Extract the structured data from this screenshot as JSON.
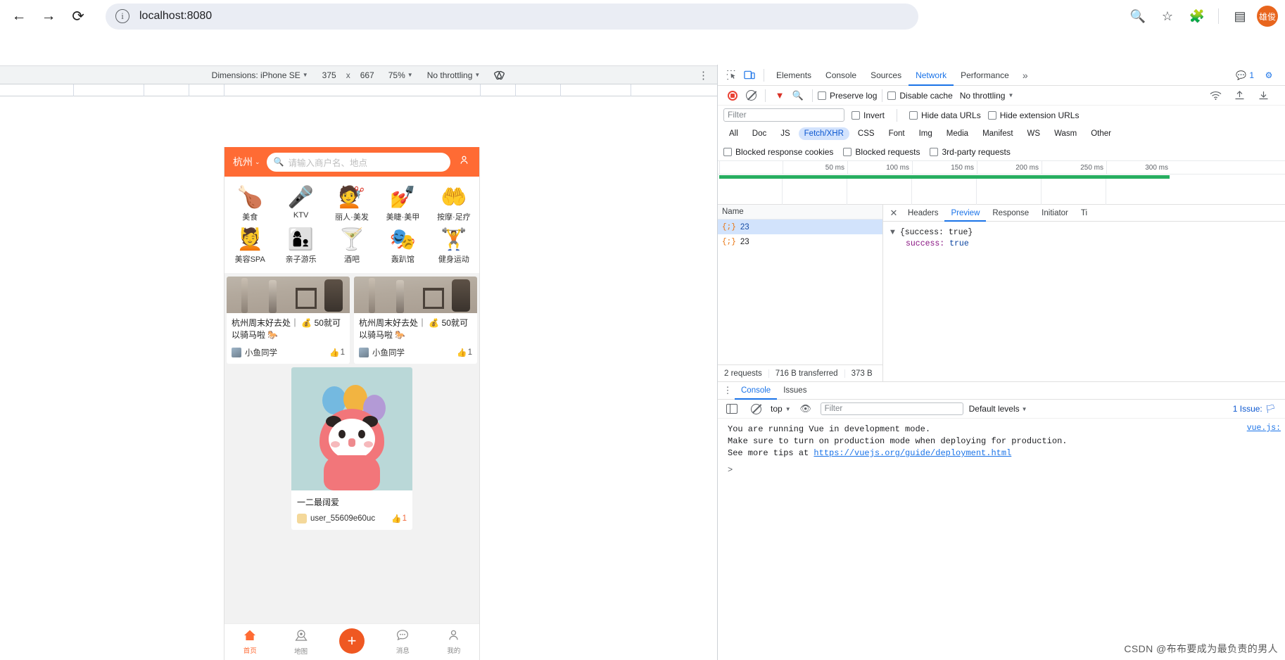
{
  "browser": {
    "back_icon": "back-arrow",
    "forward_icon": "forward-arrow",
    "reload_icon": "reload",
    "site_info_icon": "info",
    "url": "localhost:8080",
    "zoom_icon": "zoom-search",
    "bookmark_icon": "star",
    "extensions_icon": "puzzle",
    "sidepanel_icon": "side-panel",
    "profile_initials": "雄俊"
  },
  "device_toolbar": {
    "dimensions_label": "Dimensions: iPhone SE",
    "width": "375",
    "x": "x",
    "height": "667",
    "zoom": "75%",
    "throttling": "No throttling",
    "rotate_icon": "rotate-device",
    "kebab_icon": "more-options"
  },
  "mobile": {
    "header": {
      "city": "杭州",
      "chevron_icon": "chevron-down",
      "search_icon": "search",
      "search_placeholder": "请输入商户名、地点",
      "user_icon": "user-outline"
    },
    "categories": [
      {
        "icon": "roast-turkey",
        "glyph": "🍗",
        "label": "美食"
      },
      {
        "icon": "microphone",
        "glyph": "🎤",
        "label": "KTV"
      },
      {
        "icon": "woman-hair",
        "glyph": "💇",
        "label": "丽人·美发"
      },
      {
        "icon": "nail-polish",
        "glyph": "💅",
        "label": "美睫·美甲"
      },
      {
        "icon": "massage-hands",
        "glyph": "🤲",
        "label": "按摩·足疗"
      },
      {
        "icon": "face-mask",
        "glyph": "💆",
        "label": "美容SPA"
      },
      {
        "icon": "parent-child",
        "glyph": "👩‍👦",
        "label": "亲子游乐"
      },
      {
        "icon": "cocktail",
        "glyph": "🍸",
        "label": "酒吧"
      },
      {
        "icon": "party-mask",
        "glyph": "🎭",
        "label": "轰趴馆"
      },
      {
        "icon": "dumbbell",
        "glyph": "🏋",
        "label": "健身运动"
      }
    ],
    "notes": [
      {
        "title": "杭州周末好去处｜ 💰 50就可以骑马啦 🐎",
        "user": "小鱼同学",
        "likes": "1",
        "like_icon": "thumbs-up",
        "image_alt": "horse-legs-photo"
      },
      {
        "title": "杭州周末好去处｜ 💰 50就可以骑马啦 🐎",
        "user": "小鱼同学",
        "likes": "1",
        "like_icon": "thumbs-up",
        "image_alt": "horse-legs-photo"
      }
    ],
    "feature_card": {
      "title": "一二最阔爱",
      "user": "user_55609e60uc",
      "likes": "1",
      "like_icon": "thumbs-up",
      "image_alt": "panda-with-balloons"
    },
    "tabbar": [
      {
        "icon": "home",
        "glyph": "⌂",
        "label": "首页",
        "active": true
      },
      {
        "icon": "map-pin",
        "glyph": "◎",
        "label": "地图",
        "active": false
      },
      {
        "icon": "plus",
        "glyph": "+",
        "label": "",
        "active": false
      },
      {
        "icon": "chat-bubble",
        "glyph": "⋯",
        "label": "消息",
        "active": false
      },
      {
        "icon": "person",
        "glyph": "◠",
        "label": "我的",
        "active": false
      }
    ]
  },
  "devtools": {
    "inspect_icon": "inspect-element",
    "device_icon": "toggle-device-toolbar",
    "tabs": [
      "Elements",
      "Console",
      "Sources",
      "Network",
      "Performance"
    ],
    "selected_tab": "Network",
    "more_tabs_icon": "chevron-double-right",
    "messages_icon": "message-bubble",
    "messages_count": "1",
    "settings_icon": "gear",
    "network": {
      "record_icon": "record",
      "clear_icon": "clear",
      "filter_icon": "filter-funnel",
      "search_icon": "search",
      "preserve_log": "Preserve log",
      "disable_cache": "Disable cache",
      "throttling": "No throttling",
      "wifi_icon": "wifi",
      "import_icon": "upload",
      "export_icon": "download",
      "filter_placeholder": "Filter",
      "invert": "Invert",
      "hide_data_urls": "Hide data URLs",
      "hide_extension_urls": "Hide extension URLs",
      "types": [
        "All",
        "Doc",
        "JS",
        "Fetch/XHR",
        "CSS",
        "Font",
        "Img",
        "Media",
        "Manifest",
        "WS",
        "Wasm",
        "Other"
      ],
      "selected_type": "Fetch/XHR",
      "blocked_response_cookies": "Blocked response cookies",
      "blocked_requests": "Blocked requests",
      "third_party_requests": "3rd-party requests",
      "timeline_ticks": [
        "50 ms",
        "100 ms",
        "150 ms",
        "200 ms",
        "250 ms",
        "300 ms"
      ],
      "name_column": "Name",
      "requests": [
        {
          "icon": "json-braces",
          "name": "23",
          "selected": true
        },
        {
          "icon": "json-braces",
          "name": "23",
          "selected": false
        }
      ],
      "summary": [
        "2 requests",
        "716 B transferred",
        "373 B"
      ],
      "detail_tabs": [
        "Headers",
        "Preview",
        "Response",
        "Initiator",
        "Ti"
      ],
      "selected_detail_tab": "Preview",
      "close_icon": "close-x",
      "preview": {
        "arrow_icon": "triangle-down",
        "root": "{success: true}",
        "key": "success:",
        "value": "true"
      }
    },
    "console": {
      "kebab_icon": "more-options",
      "tabs": [
        "Console",
        "Issues"
      ],
      "selected_tab": "Console",
      "sidebar_icon": "toggle-sidebar",
      "clear_icon": "clear-console",
      "context": "top",
      "eye_icon": "live-expression",
      "filter_placeholder": "Filter",
      "levels": "Default levels",
      "issues_text": "1 Issue:",
      "issues_icon": "issue-marker",
      "messages": [
        "You are running Vue in development mode.",
        "Make sure to turn on production mode when deploying for production.",
        "See more tips at "
      ],
      "message_link": "https://vuejs.org/guide/deployment.html",
      "source_link": "vue.js:",
      "prompt_icon": "chevron-right-prompt"
    }
  },
  "watermark": "CSDN @布布要成为最负责的男人"
}
